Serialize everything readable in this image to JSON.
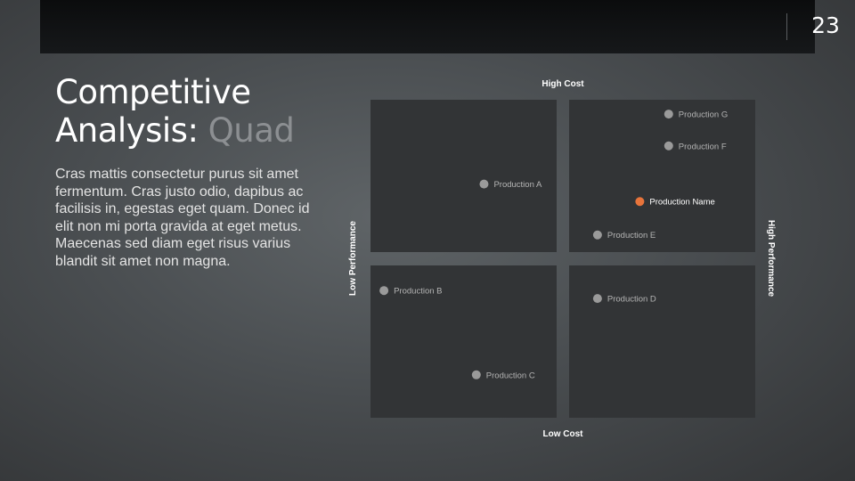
{
  "slide": {
    "number": "23",
    "title_main": "Competitive",
    "title_line2": "Analysis: ",
    "title_accent": "Quad",
    "body": "Cras mattis consectetur purus sit amet fermentum. Cras justo odio, dapibus ac facilisis in, egestas eget quam. Donec id elit non mi porta gravida at eget metus. Maecenas sed diam eget risus varius blandit sit amet non magna."
  },
  "chart_data": {
    "type": "scatter",
    "axes": {
      "top_label": "High Cost",
      "bottom_label": "Low Cost",
      "left_label": "Low Performance",
      "right_label": "High Performance"
    },
    "xlim": [
      -1,
      1
    ],
    "ylim": [
      -1,
      1
    ],
    "grid": false,
    "colors": {
      "default_point": "#9a9a9a",
      "highlight_point": "#e8743b",
      "quadrant_fill": "#323436"
    },
    "points": [
      {
        "label": "Production A",
        "x": -0.41,
        "y": 0.47,
        "highlight": false
      },
      {
        "label": "Production B",
        "x": -0.93,
        "y": -0.2,
        "highlight": false
      },
      {
        "label": "Production C",
        "x": -0.45,
        "y": -0.73,
        "highlight": false
      },
      {
        "label": "Production D",
        "x": 0.18,
        "y": -0.25,
        "highlight": false
      },
      {
        "label": "Production E",
        "x": 0.18,
        "y": 0.15,
        "highlight": false
      },
      {
        "label": "Production F",
        "x": 0.55,
        "y": 0.71,
        "highlight": false
      },
      {
        "label": "Production G",
        "x": 0.55,
        "y": 0.91,
        "highlight": false
      },
      {
        "label": "Production Name",
        "x": 0.4,
        "y": 0.36,
        "highlight": true
      }
    ]
  }
}
